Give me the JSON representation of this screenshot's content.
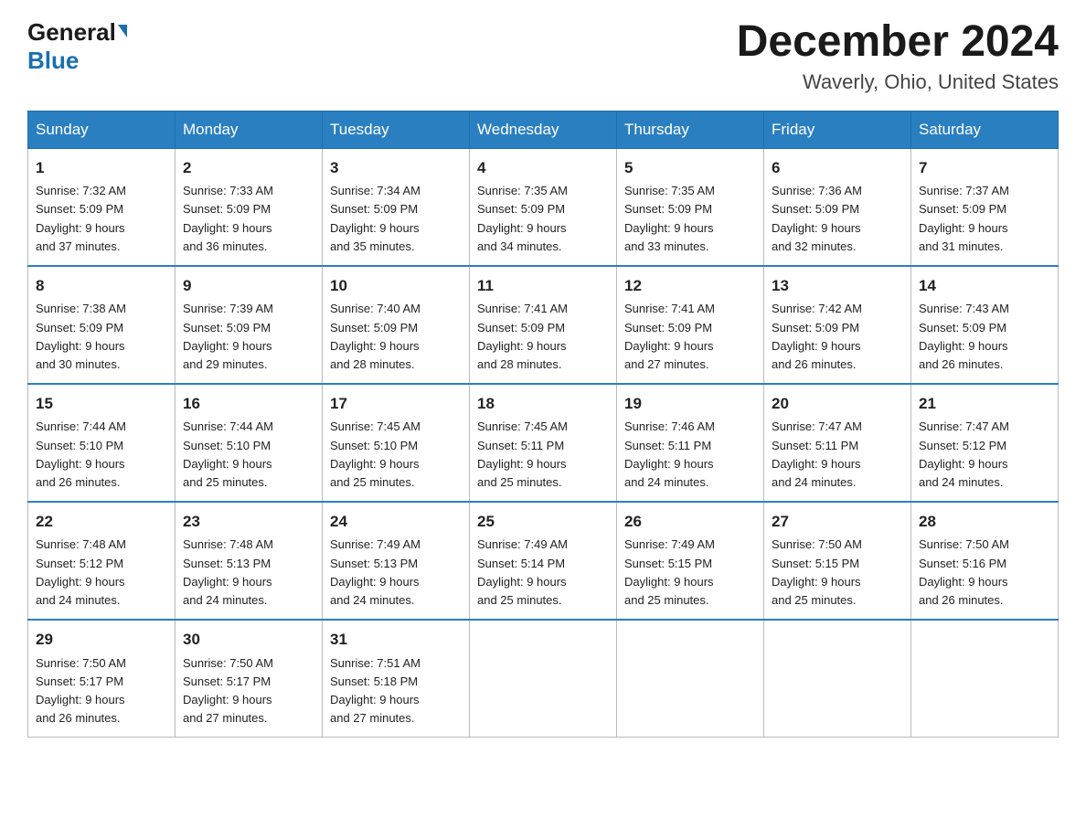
{
  "logo": {
    "general": "General",
    "blue": "Blue"
  },
  "title": {
    "month_year": "December 2024",
    "location": "Waverly, Ohio, United States"
  },
  "headers": [
    "Sunday",
    "Monday",
    "Tuesday",
    "Wednesday",
    "Thursday",
    "Friday",
    "Saturday"
  ],
  "weeks": [
    [
      {
        "day": "1",
        "sunrise": "7:32 AM",
        "sunset": "5:09 PM",
        "daylight": "9 hours and 37 minutes."
      },
      {
        "day": "2",
        "sunrise": "7:33 AM",
        "sunset": "5:09 PM",
        "daylight": "9 hours and 36 minutes."
      },
      {
        "day": "3",
        "sunrise": "7:34 AM",
        "sunset": "5:09 PM",
        "daylight": "9 hours and 35 minutes."
      },
      {
        "day": "4",
        "sunrise": "7:35 AM",
        "sunset": "5:09 PM",
        "daylight": "9 hours and 34 minutes."
      },
      {
        "day": "5",
        "sunrise": "7:35 AM",
        "sunset": "5:09 PM",
        "daylight": "9 hours and 33 minutes."
      },
      {
        "day": "6",
        "sunrise": "7:36 AM",
        "sunset": "5:09 PM",
        "daylight": "9 hours and 32 minutes."
      },
      {
        "day": "7",
        "sunrise": "7:37 AM",
        "sunset": "5:09 PM",
        "daylight": "9 hours and 31 minutes."
      }
    ],
    [
      {
        "day": "8",
        "sunrise": "7:38 AM",
        "sunset": "5:09 PM",
        "daylight": "9 hours and 30 minutes."
      },
      {
        "day": "9",
        "sunrise": "7:39 AM",
        "sunset": "5:09 PM",
        "daylight": "9 hours and 29 minutes."
      },
      {
        "day": "10",
        "sunrise": "7:40 AM",
        "sunset": "5:09 PM",
        "daylight": "9 hours and 28 minutes."
      },
      {
        "day": "11",
        "sunrise": "7:41 AM",
        "sunset": "5:09 PM",
        "daylight": "9 hours and 28 minutes."
      },
      {
        "day": "12",
        "sunrise": "7:41 AM",
        "sunset": "5:09 PM",
        "daylight": "9 hours and 27 minutes."
      },
      {
        "day": "13",
        "sunrise": "7:42 AM",
        "sunset": "5:09 PM",
        "daylight": "9 hours and 26 minutes."
      },
      {
        "day": "14",
        "sunrise": "7:43 AM",
        "sunset": "5:09 PM",
        "daylight": "9 hours and 26 minutes."
      }
    ],
    [
      {
        "day": "15",
        "sunrise": "7:44 AM",
        "sunset": "5:10 PM",
        "daylight": "9 hours and 26 minutes."
      },
      {
        "day": "16",
        "sunrise": "7:44 AM",
        "sunset": "5:10 PM",
        "daylight": "9 hours and 25 minutes."
      },
      {
        "day": "17",
        "sunrise": "7:45 AM",
        "sunset": "5:10 PM",
        "daylight": "9 hours and 25 minutes."
      },
      {
        "day": "18",
        "sunrise": "7:45 AM",
        "sunset": "5:11 PM",
        "daylight": "9 hours and 25 minutes."
      },
      {
        "day": "19",
        "sunrise": "7:46 AM",
        "sunset": "5:11 PM",
        "daylight": "9 hours and 24 minutes."
      },
      {
        "day": "20",
        "sunrise": "7:47 AM",
        "sunset": "5:11 PM",
        "daylight": "9 hours and 24 minutes."
      },
      {
        "day": "21",
        "sunrise": "7:47 AM",
        "sunset": "5:12 PM",
        "daylight": "9 hours and 24 minutes."
      }
    ],
    [
      {
        "day": "22",
        "sunrise": "7:48 AM",
        "sunset": "5:12 PM",
        "daylight": "9 hours and 24 minutes."
      },
      {
        "day": "23",
        "sunrise": "7:48 AM",
        "sunset": "5:13 PM",
        "daylight": "9 hours and 24 minutes."
      },
      {
        "day": "24",
        "sunrise": "7:49 AM",
        "sunset": "5:13 PM",
        "daylight": "9 hours and 24 minutes."
      },
      {
        "day": "25",
        "sunrise": "7:49 AM",
        "sunset": "5:14 PM",
        "daylight": "9 hours and 25 minutes."
      },
      {
        "day": "26",
        "sunrise": "7:49 AM",
        "sunset": "5:15 PM",
        "daylight": "9 hours and 25 minutes."
      },
      {
        "day": "27",
        "sunrise": "7:50 AM",
        "sunset": "5:15 PM",
        "daylight": "9 hours and 25 minutes."
      },
      {
        "day": "28",
        "sunrise": "7:50 AM",
        "sunset": "5:16 PM",
        "daylight": "9 hours and 26 minutes."
      }
    ],
    [
      {
        "day": "29",
        "sunrise": "7:50 AM",
        "sunset": "5:17 PM",
        "daylight": "9 hours and 26 minutes."
      },
      {
        "day": "30",
        "sunrise": "7:50 AM",
        "sunset": "5:17 PM",
        "daylight": "9 hours and 27 minutes."
      },
      {
        "day": "31",
        "sunrise": "7:51 AM",
        "sunset": "5:18 PM",
        "daylight": "9 hours and 27 minutes."
      },
      null,
      null,
      null,
      null
    ]
  ],
  "labels": {
    "sunrise": "Sunrise:",
    "sunset": "Sunset:",
    "daylight": "Daylight:"
  }
}
